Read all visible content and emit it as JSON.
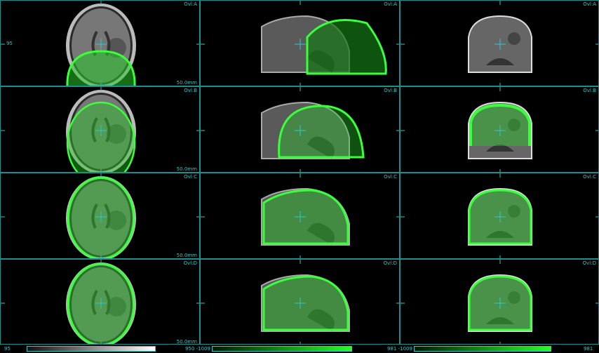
{
  "rows": [
    {
      "overlay": "Ovl:A",
      "fill": 0.1,
      "scale": "50.0mm"
    },
    {
      "overlay": "Ovl:B",
      "fill": 0.35,
      "scale": "50.0mm"
    },
    {
      "overlay": "Ovl:C",
      "fill": 0.55,
      "scale": "50.0mm"
    },
    {
      "overlay": "Ovl:D",
      "fill": 0.6,
      "scale": "50.0mm"
    }
  ],
  "views": [
    "axial",
    "sagittal",
    "coronal"
  ],
  "slice_index": "95",
  "colorbars": [
    {
      "left_label": "",
      "right_label": "950 -1009",
      "style": "gray"
    },
    {
      "left_label": "",
      "right_label": "981 -1009",
      "style": "green"
    },
    {
      "left_label": "",
      "right_label": "981",
      "style": "green"
    }
  ],
  "colors": {
    "accent": "#33c6c6",
    "overlay": "#2ee02e"
  }
}
